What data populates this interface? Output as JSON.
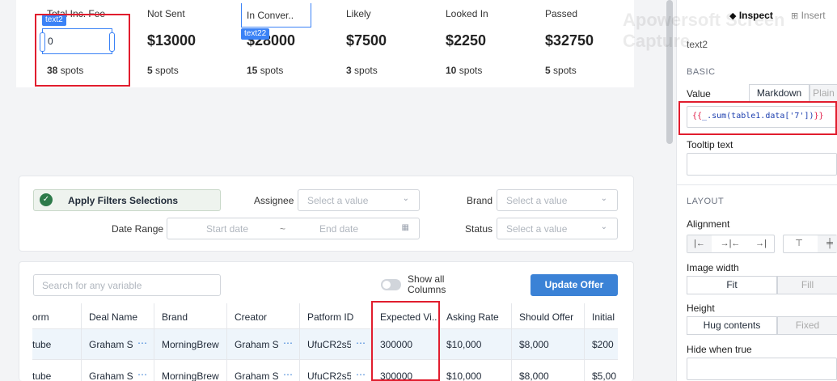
{
  "stats": [
    {
      "label": "Total Inc. Fee",
      "amount": "",
      "count": "38",
      "unit": "spots"
    },
    {
      "label": "Not Sent",
      "amount": "$13000",
      "count": "5",
      "unit": "spots"
    },
    {
      "label": "In Conver..",
      "amount": "$28000",
      "count": "15",
      "unit": "spots"
    },
    {
      "label": "Likely",
      "amount": "$7500",
      "count": "3",
      "unit": "spots"
    },
    {
      "label": "Looked In",
      "amount": "$2250",
      "count": "10",
      "unit": "spots"
    },
    {
      "label": "Passed",
      "amount": "$32750",
      "count": "5",
      "unit": "spots"
    }
  ],
  "selected": {
    "tag1": "text2",
    "tag2": "text22",
    "input_value": "0"
  },
  "filters": {
    "apply_label": "Apply Filters Selections",
    "assignee_label": "Assignee",
    "assignee_placeholder": "Select a value",
    "brand_label": "Brand",
    "brand_placeholder": "Select a value",
    "date_range_label": "Date Range",
    "start_placeholder": "Start date",
    "range_sep": "~",
    "end_placeholder": "End date",
    "status_label": "Status",
    "status_placeholder": "Select a value"
  },
  "table": {
    "search_placeholder": "Search for any variable",
    "show_all_label": "Show all Columns",
    "update_label": "Update Offer",
    "headers": [
      "orm",
      "Deal Name",
      "Brand",
      "Creator",
      "Patform ID",
      "Expected Vi...",
      "Asking Rate",
      "Should Offer",
      "Initial O"
    ],
    "rows": [
      [
        "tube",
        "Graham St",
        "MorningBrew",
        "Graham St",
        "UfuCR2s5",
        "300000",
        "$10,000",
        "$8,000",
        "$200"
      ],
      [
        "tube",
        "Graham St",
        "MorningBrew",
        "Graham St",
        "UfuCR2s5",
        "300000",
        "$10,000",
        "$8,000",
        "$5,00"
      ]
    ],
    "more_icon": "⋯"
  },
  "panel": {
    "tab_inspect": "Inspect",
    "tab_insert": "Insert",
    "component_name": "text2",
    "basic_header": "BASIC",
    "value_label": "Value",
    "markdown_label": "Markdown",
    "plain_label": "Plain",
    "value_code_open": "{{",
    "value_code_body": "_.sum(table1.data['7'])",
    "value_code_close": "}}",
    "tooltip_label": "Tooltip text",
    "layout_header": "LAYOUT",
    "alignment_label": "Alignment",
    "image_width_label": "Image width",
    "fit_label": "Fit",
    "fill_label": "Fill",
    "height_label": "Height",
    "hug_label": "Hug contents",
    "fixed_label": "Fixed",
    "hide_when_label": "Hide when true"
  },
  "watermark": "Apowersoft Screen Capture",
  "colors": {
    "accent": "#3b82d6",
    "highlight": "#e11d2e",
    "success": "#2d7a4a"
  }
}
